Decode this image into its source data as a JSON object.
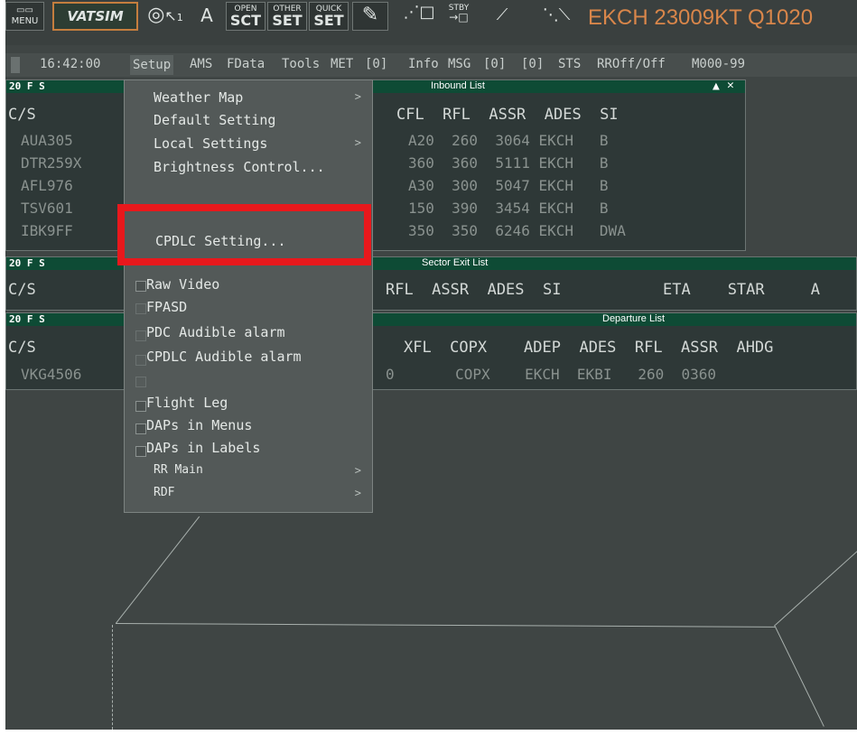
{
  "toolbar": {
    "menu_label": "MENU",
    "vatsim_label": "VATSIM",
    "a_label": "A",
    "open_small": "OPEN",
    "open_big": "SCT",
    "other_small": "OTHER",
    "other_big": "SET",
    "quick_small": "QUICK",
    "quick_big": "SET",
    "stby_small": "STBY",
    "stby_big": "→□",
    "metar": "EKCH 23009KT Q1020"
  },
  "status": {
    "time": "16:42:00",
    "items": [
      "Setup",
      "AMS",
      "FData",
      "Tools",
      "MET",
      "[0]",
      "Info",
      "MSG",
      "[0]",
      "[0]",
      "STS",
      "RROff/Off",
      "M000-99"
    ]
  },
  "inbound": {
    "title": "Inbound List",
    "prefix": "20 F S",
    "header_cs": "C/S",
    "header_rest": "CFL  RFL  ASSR  ADES  SI",
    "rows": [
      {
        "cs": "AUA305",
        "rest": "A20  260  3064 EKCH   B"
      },
      {
        "cs": "DTR259X",
        "rest": "360  360  5111 EKCH   B"
      },
      {
        "cs": "AFL976",
        "rest": "A30  300  5047 EKCH   B"
      },
      {
        "cs": "TSV601",
        "rest": "150  390  3454 EKCH   B"
      },
      {
        "cs": "IBK9FF",
        "rest": "350  350  6246 EKCH   DWA"
      }
    ]
  },
  "sector_exit": {
    "title": "Sector Exit List",
    "prefix": "20 F S",
    "header_cs": "C/S",
    "header_rest": "RFL  ASSR  ADES  SI           ETA    STAR     A"
  },
  "departure": {
    "title": "Departure List",
    "prefix": "20 F S",
    "header_cs": "C/S",
    "header_rest": "XFL  COPX    ADEP  ADES  RFL  ASSR  AHDG",
    "rows": [
      {
        "cs": "VKG4506",
        "rest": "0       COPX    EKCH  EKBI   260  0360"
      }
    ]
  },
  "setup_menu": {
    "items": [
      {
        "label": "Weather Map",
        "sub": ">"
      },
      {
        "label": "Default Setting",
        "sub": ""
      },
      {
        "label": "Local Settings",
        "sub": ">"
      },
      {
        "label": "Brightness Control...",
        "sub": ""
      },
      {
        "label": "CPDLC Setting...",
        "sub": ""
      },
      {
        "label": "Raw Video",
        "sub": ""
      },
      {
        "label": "FPASD",
        "sub": ""
      },
      {
        "label": "PDC Audible alarm",
        "sub": ""
      },
      {
        "label": "CPDLC Audible alarm",
        "sub": ""
      },
      {
        "label": "Flight Leg",
        "sub": ""
      },
      {
        "label": "DAPs in Menus",
        "sub": ""
      },
      {
        "label": "DAPs in Labels",
        "sub": ""
      },
      {
        "label": "RR Main",
        "sub": ">"
      },
      {
        "label": "RDF",
        "sub": ">"
      }
    ]
  },
  "colors": {
    "accent": "#d9864a",
    "window_header": "#0e4b35",
    "highlight": "#e8181c"
  }
}
